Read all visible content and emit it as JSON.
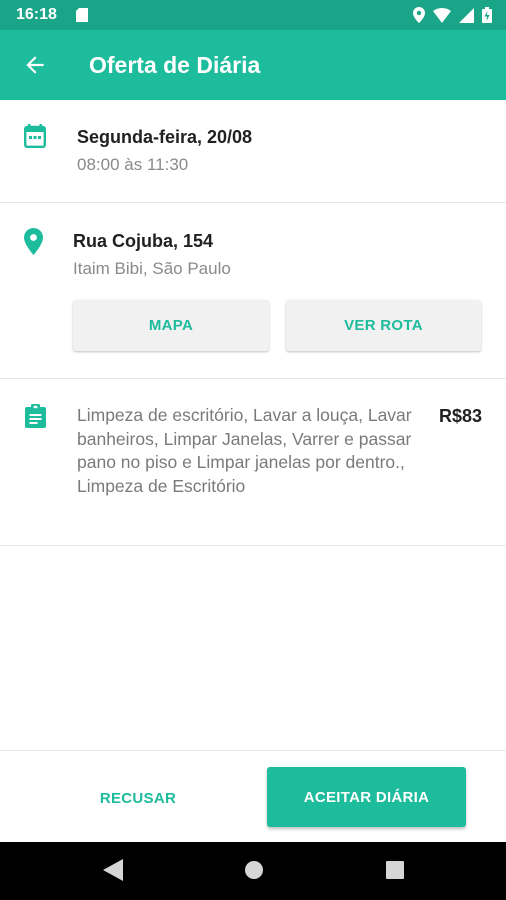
{
  "status_bar": {
    "time": "16:18",
    "icons": [
      "sd-card-icon",
      "location-icon",
      "wifi-icon",
      "signal-icon",
      "battery-icon"
    ]
  },
  "app_bar": {
    "title": "Oferta de Diária",
    "back_icon": "arrow-back-icon"
  },
  "schedule": {
    "icon": "calendar-icon",
    "date": "Segunda-feira, 20/08",
    "time_range": "08:00 às 11:30"
  },
  "address": {
    "icon": "location-pin-icon",
    "street": "Rua Cojuba, 154",
    "district": "Itaim Bibi, São Paulo",
    "map_button": "MAPA",
    "route_button": "VER ROTA"
  },
  "services": {
    "icon": "clipboard-icon",
    "description": "Limpeza de escritório, Lavar a louça, Lavar banheiros, Limpar Janelas, Varrer e passar pano no piso e Limpar janelas por dentro., Limpeza de Escritório",
    "price": "R$83"
  },
  "actions": {
    "refuse": "RECUSAR",
    "accept": "ACEITAR DIÁRIA"
  },
  "colors": {
    "primary": "#1dbc9c",
    "primary_dark": "#1aa589"
  },
  "nav_bar": [
    "back-triangle-icon",
    "home-circle-icon",
    "recents-square-icon"
  ]
}
